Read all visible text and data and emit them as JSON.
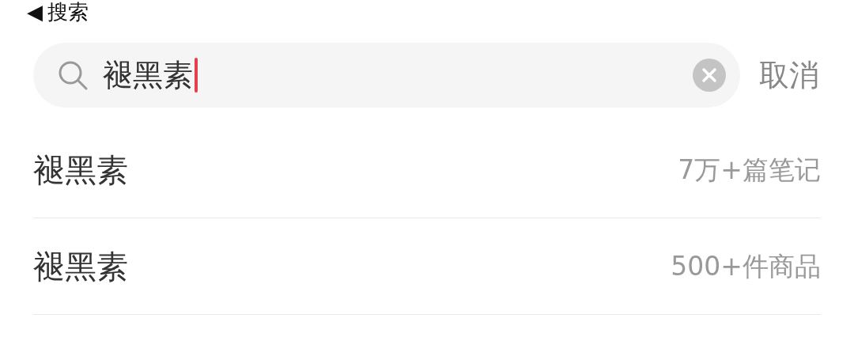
{
  "back_link": {
    "icon": "◀",
    "label": "搜索"
  },
  "search": {
    "value": "褪黑素",
    "focused": true
  },
  "cancel_button": "取消",
  "suggestions": [
    {
      "term": "褪黑素",
      "count": "7万+篇笔记"
    },
    {
      "term": "褪黑素",
      "count": "500+件商品"
    }
  ]
}
